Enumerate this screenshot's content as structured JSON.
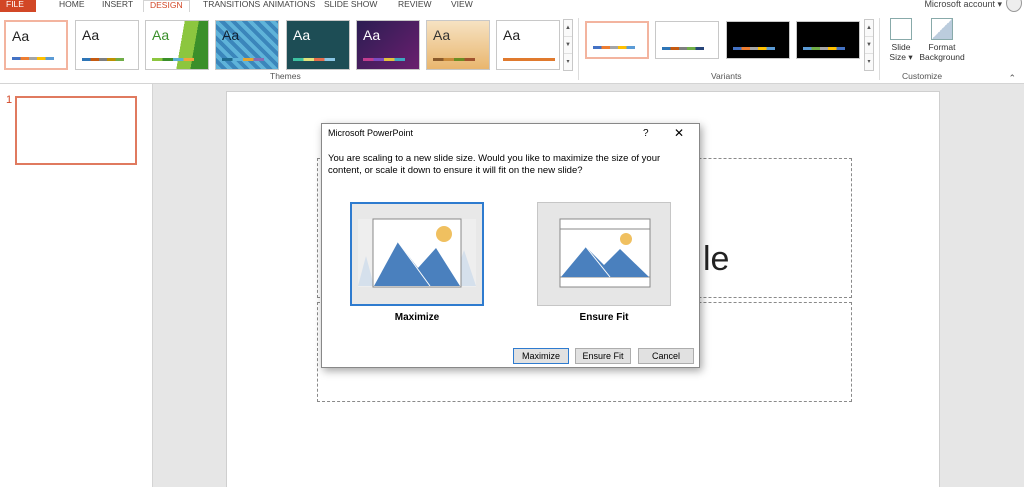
{
  "menu": {
    "tabs": [
      "FILE",
      "HOME",
      "INSERT",
      "DESIGN",
      "TRANSITIONS",
      "ANIMATIONS",
      "SLIDE SHOW",
      "REVIEW",
      "VIEW"
    ],
    "active_tab": "DESIGN",
    "account": "Microsoft account"
  },
  "ribbon": {
    "themes_label": "Themes",
    "variants_label": "Variants",
    "customize_label": "Customize",
    "theme_sample": "Aa",
    "slide_size": "Slide Size",
    "format_background": "Format Background"
  },
  "slide": {
    "number": "1",
    "title_fragment": "le"
  },
  "dialog": {
    "title": "Microsoft PowerPoint",
    "help": "?",
    "close": "✕",
    "message": "You are scaling to a new slide size.  Would you like to maximize the size of your content, or scale it down to ensure it will fit on the new slide?",
    "option_maximize": "Maximize",
    "option_ensure_fit": "Ensure Fit",
    "btn_maximize": "Maximize",
    "btn_ensure_fit": "Ensure Fit",
    "btn_cancel": "Cancel"
  },
  "colors": {
    "accent": "#d24726",
    "selection": "#2e7bcf",
    "mountain": "#4a80be",
    "sun": "#f0c060"
  }
}
